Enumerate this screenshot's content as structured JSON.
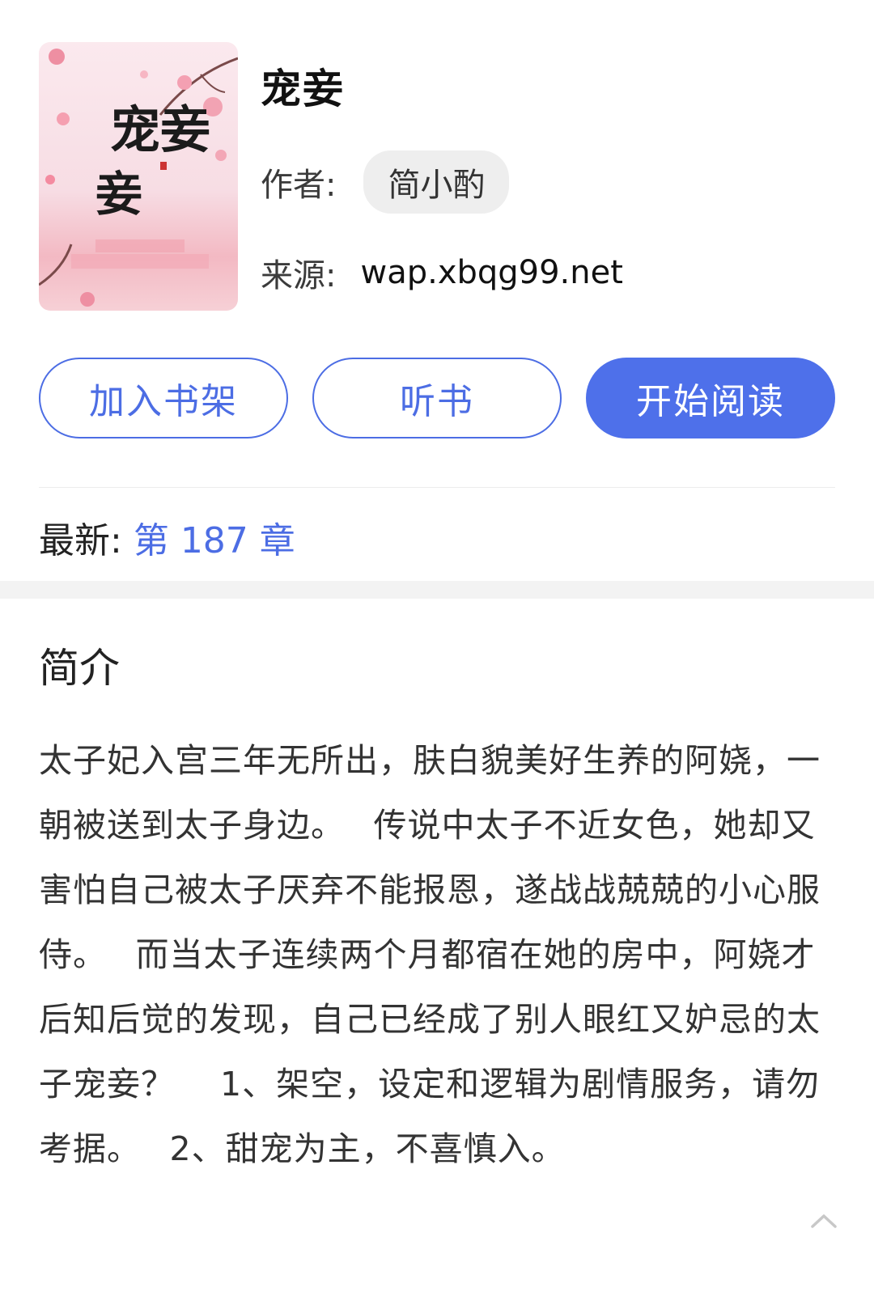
{
  "book": {
    "title": "宠妾",
    "cover_icon": "book-cover-image",
    "cover_title_text": "宠妾",
    "author_label": "作者:",
    "author_name": "简小酌",
    "source_label": "来源:",
    "source_value": "wap.xbqg99.net"
  },
  "actions": {
    "add_shelf_label": "加入书架",
    "listen_label": "听书",
    "start_reading_label": "开始阅读",
    "accent_color": "#4e70ea"
  },
  "latest": {
    "label": "最新:",
    "chapter": "第 187 章"
  },
  "synopsis": {
    "heading": "简介",
    "text": "太子妃入宫三年无所出，肤白貌美好生养的阿娆，一朝被送到太子身边。　 传说中太子不近女色，她却又害怕自己被太子厌弃不能报恩，遂战战兢兢的小心服侍。　 而当太子连续两个月都宿在她的房中，阿娆才后知后觉的发现，自己已经成了别人眼红又妒忌的太子宠妾？　 1、架空，设定和逻辑为剧情服务，请勿考据。　 2、甜宠为主，不喜慎入。",
    "collapse_icon": "chevron-up-icon"
  }
}
